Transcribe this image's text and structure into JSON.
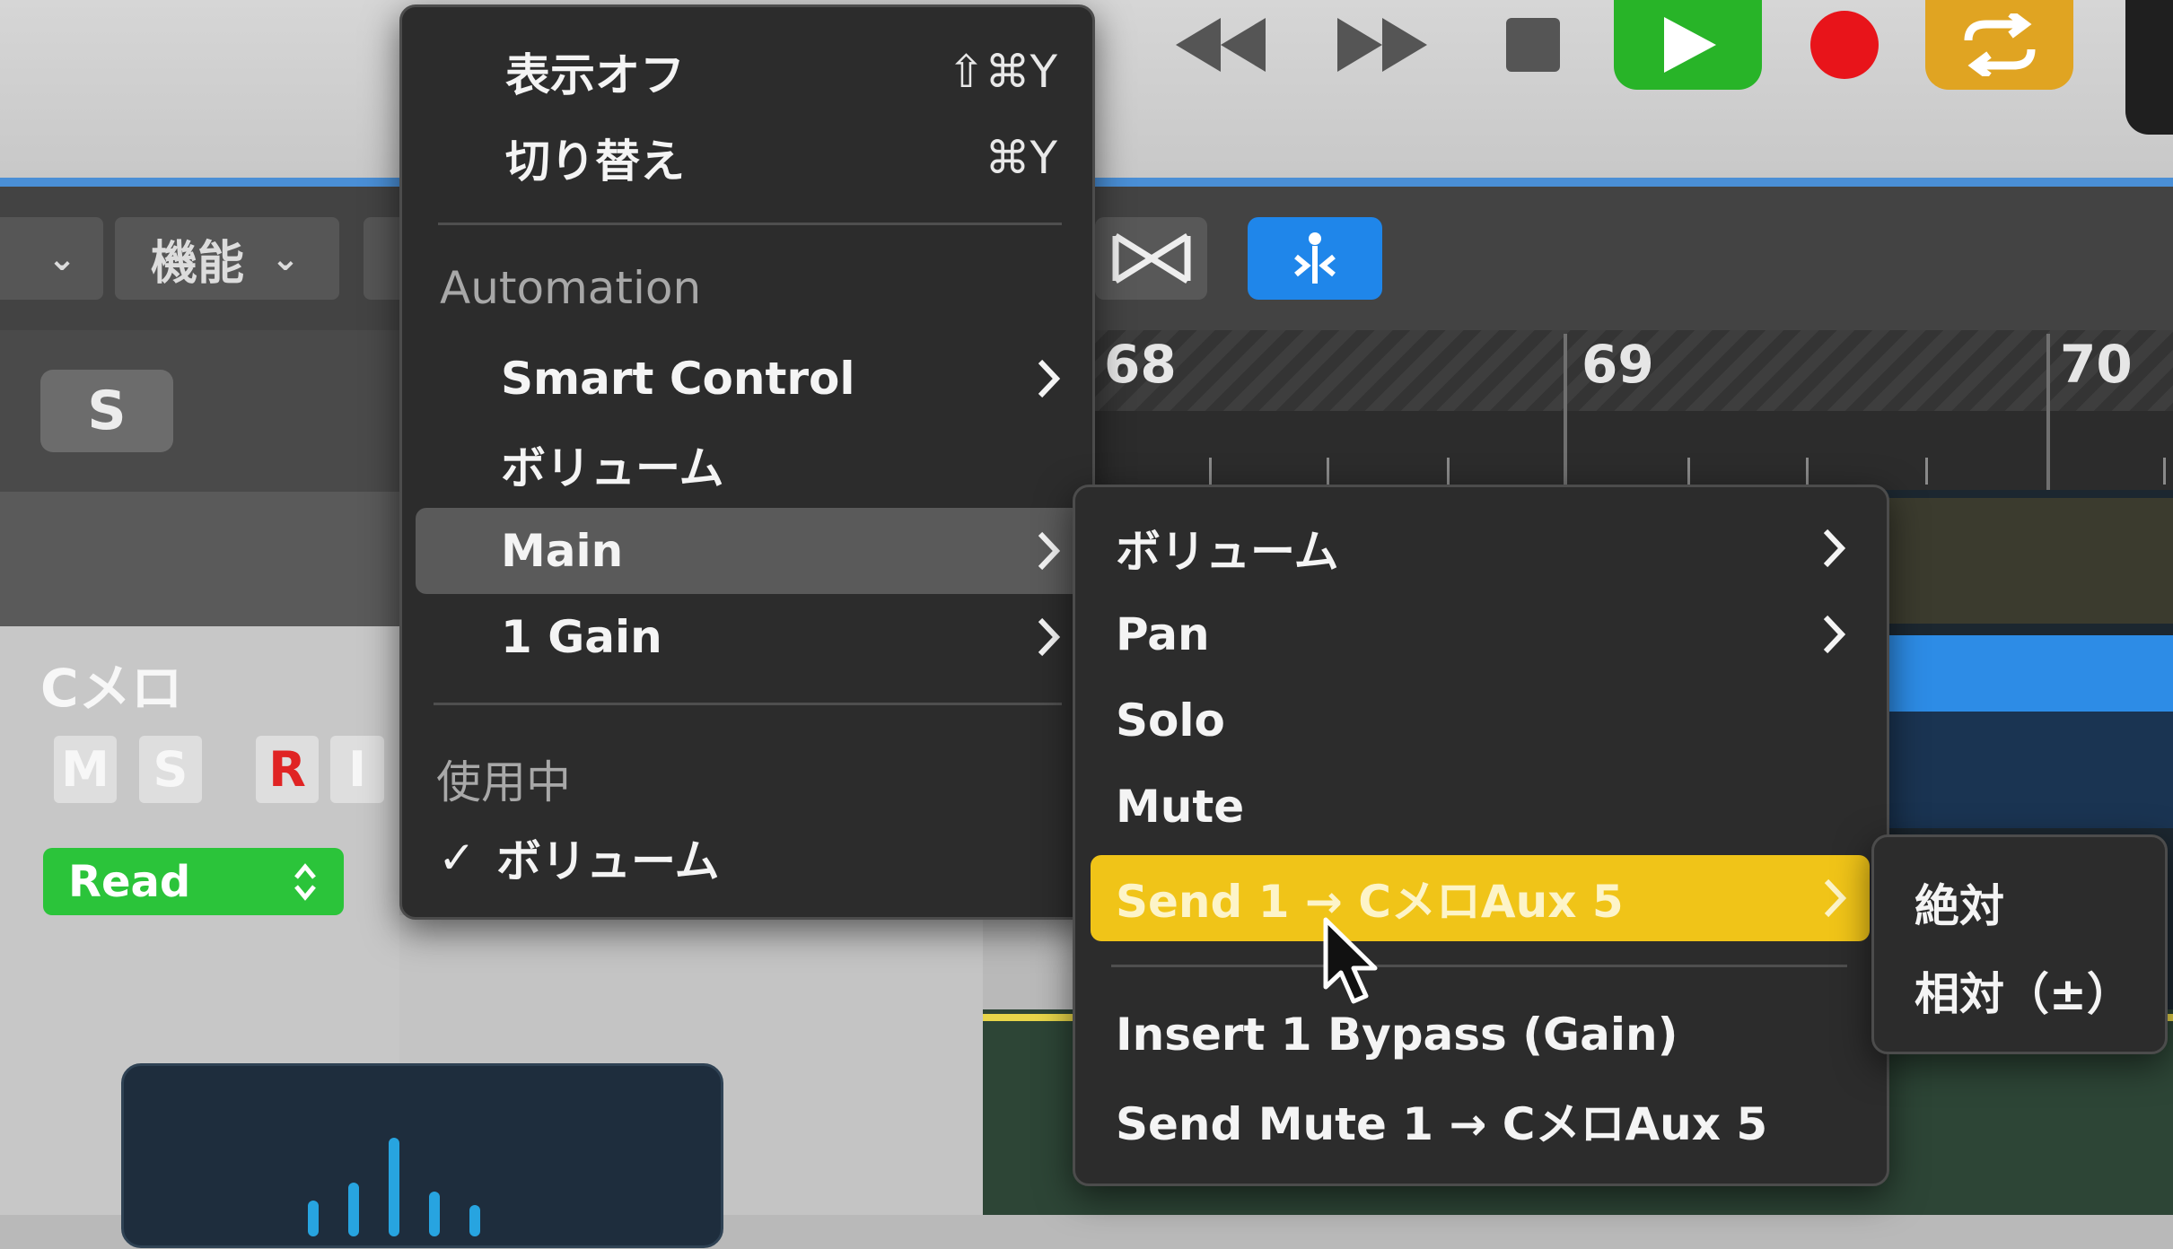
{
  "toolbar": {
    "dropdown_left_label": "",
    "functions_dropdown": "機能"
  },
  "ruler": {
    "bars": [
      "68",
      "69",
      "70"
    ]
  },
  "track": {
    "solo_button": "S",
    "name": "Cメロ",
    "mute_button": "M",
    "solo_small": "S",
    "record_button": "R",
    "input_button": "I",
    "automation_mode": "Read",
    "automation_mode_arrow": "⌃⌄"
  },
  "main_menu": {
    "items": [
      {
        "label": "表示オフ",
        "shortcut": "⇧⌘Y"
      },
      {
        "label": "切り替え",
        "shortcut": "⌘Y"
      }
    ],
    "section_automation": "Automation",
    "automation_items": [
      {
        "label": "Smart Control",
        "submenu": true
      },
      {
        "label": "ボリューム",
        "submenu": false
      },
      {
        "label": "Main",
        "submenu": true,
        "highlighted": true
      },
      {
        "label": "1 Gain",
        "submenu": true
      }
    ],
    "section_in_use": "使用中",
    "in_use_items": [
      {
        "label": "ボリューム",
        "checked": true
      }
    ]
  },
  "sub_menu": {
    "items": [
      {
        "label": "ボリューム",
        "submenu": true
      },
      {
        "label": "Pan",
        "submenu": true
      },
      {
        "label": "Solo",
        "submenu": false
      },
      {
        "label": "Mute",
        "submenu": false
      },
      {
        "label": "Send 1 → CメロAux 5",
        "submenu": true,
        "highlighted": true
      }
    ],
    "items_after_separator": [
      {
        "label": "Insert 1 Bypass (Gain)"
      },
      {
        "label": "Send Mute 1 → CメロAux 5"
      }
    ]
  },
  "third_menu": {
    "items": [
      {
        "label": "絶対"
      },
      {
        "label": "相対（±）"
      }
    ]
  },
  "glyphs": {
    "chevron_right": "›",
    "chevron_down": "⌄",
    "check": "✓"
  },
  "colors": {
    "menu_bg": "#2c2c2c",
    "highlight_grey": "#5a5a5a",
    "highlight_yellow": "#f0c418",
    "play_green": "#28b428",
    "record_red": "#e8141a",
    "cycle_orange": "#e0a422",
    "accent_blue": "#1f86ea",
    "read_green": "#2bc43a"
  }
}
